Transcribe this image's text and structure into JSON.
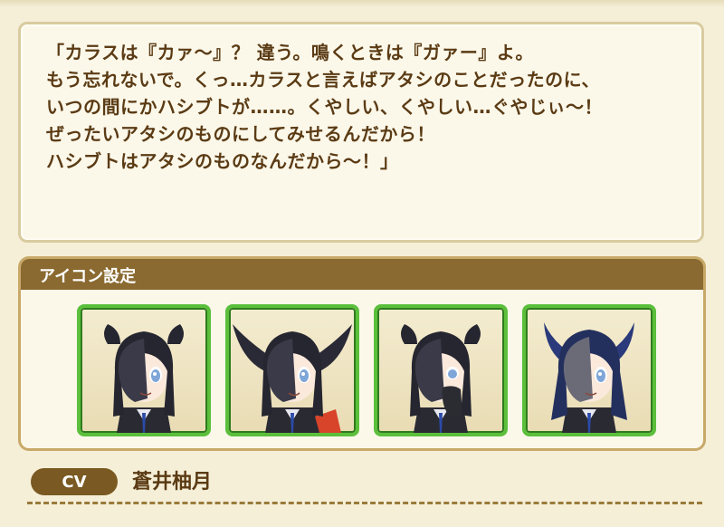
{
  "dialogue": {
    "text": "「カラスは『カァ～』？ 違う。鳴くときは『ガァー』よ。\nもう忘れないで。くっ…カラスと言えばアタシのことだったのに、\nいつの間にかハシブトが……。くやしい、くやしい…ぐやじぃ～！\nぜったいアタシのものにしてみせるんだから！\nハシブトはアタシのものなんだから～！」"
  },
  "icon_section": {
    "title": "アイコン設定",
    "icons": [
      {
        "icon": "character-icon-normal"
      },
      {
        "icon": "character-icon-wings-spread"
      },
      {
        "icon": "character-icon-hand-to-mouth"
      },
      {
        "icon": "character-icon-feather-ears"
      }
    ]
  },
  "cv": {
    "label": "CV",
    "name": "蒼井柚月"
  },
  "colors": {
    "text": "#5b3b14",
    "header": "#8a6a30",
    "icon_border": "#5bbf3b",
    "cv_badge": "#7a5a22"
  }
}
